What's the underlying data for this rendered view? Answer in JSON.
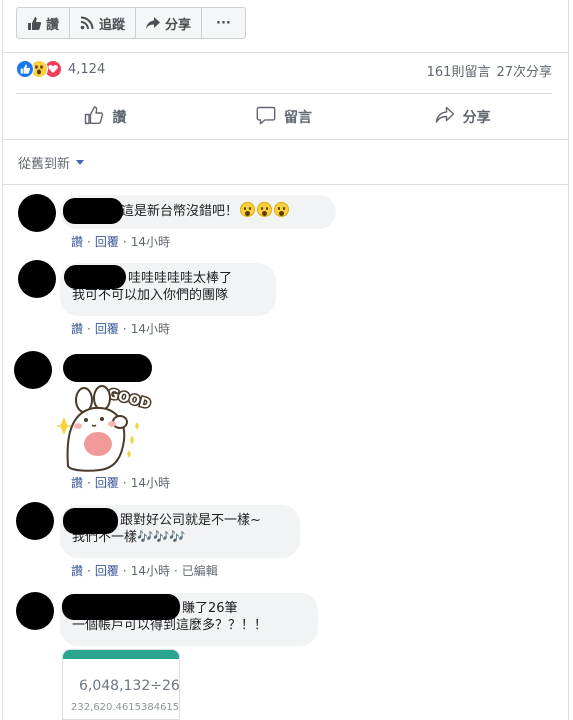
{
  "top_actions": {
    "like": "讚",
    "follow": "追蹤",
    "share": "分享",
    "more": "···"
  },
  "reactions": {
    "count": "4,124",
    "types": [
      "like-icon",
      "wow-icon",
      "love-icon"
    ],
    "colors": {
      "like": "#1877f2",
      "love": "#f33e58",
      "wow": "#fbd043"
    }
  },
  "stats": {
    "comments": "161則留言",
    "shares": "27次分享"
  },
  "main_actions": {
    "like": "讚",
    "comment": "留言",
    "share": "分享"
  },
  "sort": {
    "label": "從舊到新"
  },
  "comments": [
    {
      "text": "這是新台幣沒錯吧！",
      "emojis": 3,
      "like": "讚",
      "reply": "回覆",
      "time": "14小時"
    },
    {
      "line1": "哇哇哇哇哇太棒了",
      "line2": "我可不可以加入你們的團隊",
      "like": "讚",
      "reply": "回覆",
      "time": "14小時"
    },
    {
      "sticker_text": "GOOD",
      "like": "讚",
      "reply": "回覆",
      "time": "14小時"
    },
    {
      "line1": "跟對好公司就是不一樣~",
      "line2": "我們不一樣",
      "music": "🎶🎶🎶",
      "like": "讚",
      "reply": "回覆",
      "time": "14小時",
      "edited": "已編輯"
    },
    {
      "line1": "賺了26筆",
      "line2": "一個帳戶可以得到這麼多？？！！",
      "image": {
        "big": "6,048,132÷26",
        "small": "232,620.46153846153"
      }
    }
  ]
}
